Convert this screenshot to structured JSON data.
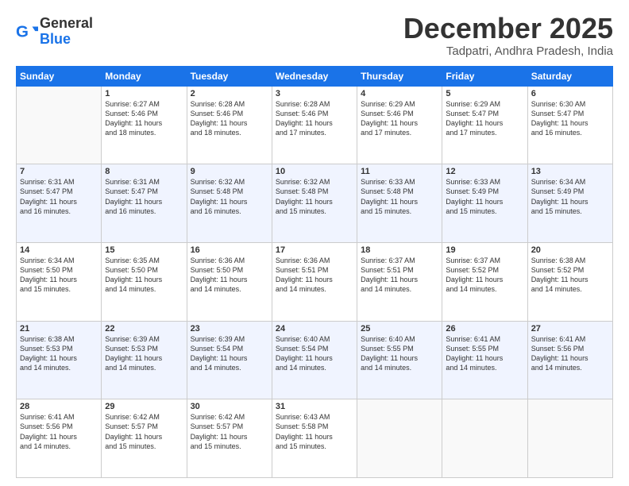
{
  "logo": {
    "general": "General",
    "blue": "Blue"
  },
  "title": "December 2025",
  "location": "Tadpatri, Andhra Pradesh, India",
  "days_of_week": [
    "Sunday",
    "Monday",
    "Tuesday",
    "Wednesday",
    "Thursday",
    "Friday",
    "Saturday"
  ],
  "weeks": [
    [
      {
        "day": "",
        "info": ""
      },
      {
        "day": "1",
        "info": "Sunrise: 6:27 AM\nSunset: 5:46 PM\nDaylight: 11 hours\nand 18 minutes."
      },
      {
        "day": "2",
        "info": "Sunrise: 6:28 AM\nSunset: 5:46 PM\nDaylight: 11 hours\nand 18 minutes."
      },
      {
        "day": "3",
        "info": "Sunrise: 6:28 AM\nSunset: 5:46 PM\nDaylight: 11 hours\nand 17 minutes."
      },
      {
        "day": "4",
        "info": "Sunrise: 6:29 AM\nSunset: 5:46 PM\nDaylight: 11 hours\nand 17 minutes."
      },
      {
        "day": "5",
        "info": "Sunrise: 6:29 AM\nSunset: 5:47 PM\nDaylight: 11 hours\nand 17 minutes."
      },
      {
        "day": "6",
        "info": "Sunrise: 6:30 AM\nSunset: 5:47 PM\nDaylight: 11 hours\nand 16 minutes."
      }
    ],
    [
      {
        "day": "7",
        "info": "Sunrise: 6:31 AM\nSunset: 5:47 PM\nDaylight: 11 hours\nand 16 minutes."
      },
      {
        "day": "8",
        "info": "Sunrise: 6:31 AM\nSunset: 5:47 PM\nDaylight: 11 hours\nand 16 minutes."
      },
      {
        "day": "9",
        "info": "Sunrise: 6:32 AM\nSunset: 5:48 PM\nDaylight: 11 hours\nand 16 minutes."
      },
      {
        "day": "10",
        "info": "Sunrise: 6:32 AM\nSunset: 5:48 PM\nDaylight: 11 hours\nand 15 minutes."
      },
      {
        "day": "11",
        "info": "Sunrise: 6:33 AM\nSunset: 5:48 PM\nDaylight: 11 hours\nand 15 minutes."
      },
      {
        "day": "12",
        "info": "Sunrise: 6:33 AM\nSunset: 5:49 PM\nDaylight: 11 hours\nand 15 minutes."
      },
      {
        "day": "13",
        "info": "Sunrise: 6:34 AM\nSunset: 5:49 PM\nDaylight: 11 hours\nand 15 minutes."
      }
    ],
    [
      {
        "day": "14",
        "info": "Sunrise: 6:34 AM\nSunset: 5:50 PM\nDaylight: 11 hours\nand 15 minutes."
      },
      {
        "day": "15",
        "info": "Sunrise: 6:35 AM\nSunset: 5:50 PM\nDaylight: 11 hours\nand 14 minutes."
      },
      {
        "day": "16",
        "info": "Sunrise: 6:36 AM\nSunset: 5:50 PM\nDaylight: 11 hours\nand 14 minutes."
      },
      {
        "day": "17",
        "info": "Sunrise: 6:36 AM\nSunset: 5:51 PM\nDaylight: 11 hours\nand 14 minutes."
      },
      {
        "day": "18",
        "info": "Sunrise: 6:37 AM\nSunset: 5:51 PM\nDaylight: 11 hours\nand 14 minutes."
      },
      {
        "day": "19",
        "info": "Sunrise: 6:37 AM\nSunset: 5:52 PM\nDaylight: 11 hours\nand 14 minutes."
      },
      {
        "day": "20",
        "info": "Sunrise: 6:38 AM\nSunset: 5:52 PM\nDaylight: 11 hours\nand 14 minutes."
      }
    ],
    [
      {
        "day": "21",
        "info": "Sunrise: 6:38 AM\nSunset: 5:53 PM\nDaylight: 11 hours\nand 14 minutes."
      },
      {
        "day": "22",
        "info": "Sunrise: 6:39 AM\nSunset: 5:53 PM\nDaylight: 11 hours\nand 14 minutes."
      },
      {
        "day": "23",
        "info": "Sunrise: 6:39 AM\nSunset: 5:54 PM\nDaylight: 11 hours\nand 14 minutes."
      },
      {
        "day": "24",
        "info": "Sunrise: 6:40 AM\nSunset: 5:54 PM\nDaylight: 11 hours\nand 14 minutes."
      },
      {
        "day": "25",
        "info": "Sunrise: 6:40 AM\nSunset: 5:55 PM\nDaylight: 11 hours\nand 14 minutes."
      },
      {
        "day": "26",
        "info": "Sunrise: 6:41 AM\nSunset: 5:55 PM\nDaylight: 11 hours\nand 14 minutes."
      },
      {
        "day": "27",
        "info": "Sunrise: 6:41 AM\nSunset: 5:56 PM\nDaylight: 11 hours\nand 14 minutes."
      }
    ],
    [
      {
        "day": "28",
        "info": "Sunrise: 6:41 AM\nSunset: 5:56 PM\nDaylight: 11 hours\nand 14 minutes."
      },
      {
        "day": "29",
        "info": "Sunrise: 6:42 AM\nSunset: 5:57 PM\nDaylight: 11 hours\nand 15 minutes."
      },
      {
        "day": "30",
        "info": "Sunrise: 6:42 AM\nSunset: 5:57 PM\nDaylight: 11 hours\nand 15 minutes."
      },
      {
        "day": "31",
        "info": "Sunrise: 6:43 AM\nSunset: 5:58 PM\nDaylight: 11 hours\nand 15 minutes."
      },
      {
        "day": "",
        "info": ""
      },
      {
        "day": "",
        "info": ""
      },
      {
        "day": "",
        "info": ""
      }
    ]
  ]
}
